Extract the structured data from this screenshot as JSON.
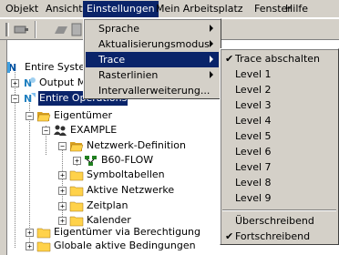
{
  "menubar": {
    "items": [
      {
        "label": "Objekt"
      },
      {
        "label": "Ansicht"
      },
      {
        "label": "Einstellungen"
      },
      {
        "label": "Mein Arbeitsplatz"
      },
      {
        "label": "Fenster"
      },
      {
        "label": "Hilfe"
      }
    ]
  },
  "einstellungen_menu": {
    "items": [
      {
        "label": "Sprache",
        "has_submenu": true
      },
      {
        "label": "Aktualisierungsmodus",
        "has_submenu": true
      },
      {
        "label": "Trace",
        "has_submenu": true,
        "highlighted": true
      },
      {
        "label": "Rasterlinien",
        "has_submenu": true
      },
      {
        "label": "Intervallerweiterung..."
      }
    ]
  },
  "trace_menu": {
    "items": [
      {
        "label": "Trace abschalten",
        "checked": true
      },
      {
        "label": "Level 1"
      },
      {
        "label": "Level 2"
      },
      {
        "label": "Level 3"
      },
      {
        "label": "Level 4"
      },
      {
        "label": "Level 5"
      },
      {
        "label": "Level 6"
      },
      {
        "label": "Level 7"
      },
      {
        "label": "Level 8"
      },
      {
        "label": "Level 9"
      }
    ],
    "items2": [
      {
        "label": "Überschreibend"
      },
      {
        "label": "Fortschreibend",
        "checked": true
      }
    ]
  },
  "tree": {
    "nodes": [
      {
        "label": "Entire System"
      },
      {
        "label": "Output M"
      },
      {
        "label": "Entire Operations",
        "selected": true
      },
      {
        "label": "Eigentümer"
      },
      {
        "label": "EXAMPLE"
      },
      {
        "label": "Netzwerk-Definition"
      },
      {
        "label": "B60-FLOW"
      },
      {
        "label": "Symboltabellen"
      },
      {
        "label": "Aktive Netzwerke"
      },
      {
        "label": "Zeitplan"
      },
      {
        "label": "Kalender"
      },
      {
        "label": "Eigentümer via Berechtigung"
      },
      {
        "label": "Globale aktive Bedingungen"
      }
    ]
  },
  "colors": {
    "highlight": "#0a246a",
    "chrome": "#d4d0c8",
    "folder": "#ffd24a"
  }
}
